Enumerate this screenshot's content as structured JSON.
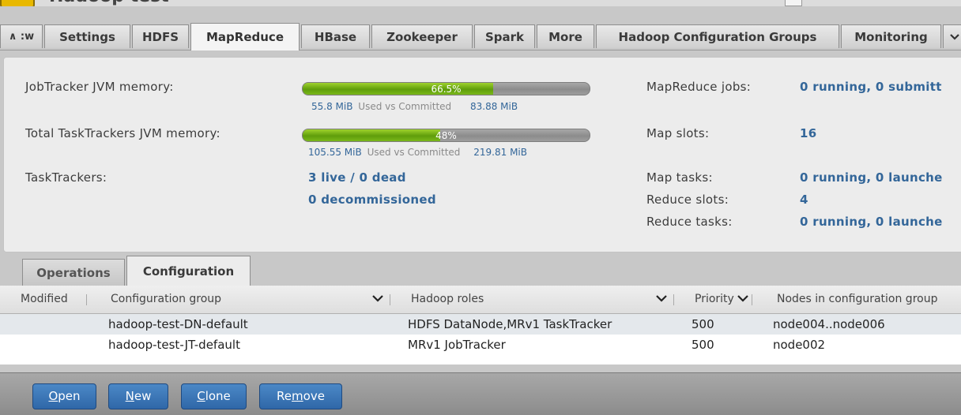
{
  "app": {
    "title": "Hadoop test"
  },
  "main_tabs": {
    "scroll_left": "∧ :w",
    "items": [
      "Settings",
      "HDFS",
      "MapReduce",
      "HBase",
      "Zookeeper",
      "Spark",
      "More",
      "Hadoop Configuration Groups",
      "Monitoring"
    ],
    "active": "MapReduce"
  },
  "summary": {
    "jt_label": "JobTracker JVM memory:",
    "jt_percent_text": "66.5%",
    "jt_fraction": 0.665,
    "jt_used": "55.8 MiB",
    "jt_caption": "Used vs Committed",
    "jt_committed": "83.88 MiB",
    "tt_label": "Total TaskTrackers JVM memory:",
    "tt_percent_text": "48%",
    "tt_fraction": 0.48,
    "tt_used": "105.55 MiB",
    "tt_caption": "Used vs Committed",
    "tt_committed": "219.81 MiB",
    "trackers_label": "TaskTrackers:",
    "trackers_live": "3 live / 0 dead",
    "trackers_decom": "0 decommissioned",
    "jobs_label": "MapReduce jobs:",
    "jobs_value": "0 running, 0 submitt",
    "map_slots_label": "Map slots:",
    "map_slots_value": "16",
    "map_tasks_label": "Map tasks:",
    "map_tasks_value": "0 running, 0 launche",
    "reduce_slots_label": "Reduce slots:",
    "reduce_slots_value": "4",
    "reduce_tasks_label": "Reduce tasks:",
    "reduce_tasks_value": "0 running, 0 launche"
  },
  "sub_tabs": {
    "operations": "Operations",
    "configuration": "Configuration",
    "active": "Configuration"
  },
  "table": {
    "headers": {
      "modified": "Modified",
      "group": "Configuration group",
      "roles": "Hadoop roles",
      "priority": "Priority",
      "nodes": "Nodes in configuration group"
    },
    "rows": [
      {
        "modified": "",
        "group": "hadoop-test-DN-default",
        "roles": "HDFS DataNode,MRv1 TaskTracker",
        "priority": "500",
        "nodes": "node004..node006"
      },
      {
        "modified": "",
        "group": "hadoop-test-JT-default",
        "roles": "MRv1 JobTracker",
        "priority": "500",
        "nodes": "node002"
      }
    ]
  },
  "buttons": {
    "open": {
      "mnemonic": "O",
      "rest": "pen"
    },
    "new": {
      "mnemonic": "N",
      "rest": "ew"
    },
    "clone": {
      "mnemonic": "C",
      "rest": "lone"
    },
    "remove": {
      "pre": "Re",
      "mnemonic": "m",
      "rest": "ove"
    }
  },
  "icons": {
    "logo": "hadoop-elephant-icon",
    "dropdown": "chevron-down-icon"
  },
  "colors": {
    "accent": "#336699",
    "progress": "#6aa812",
    "button": "#3a74b6"
  }
}
